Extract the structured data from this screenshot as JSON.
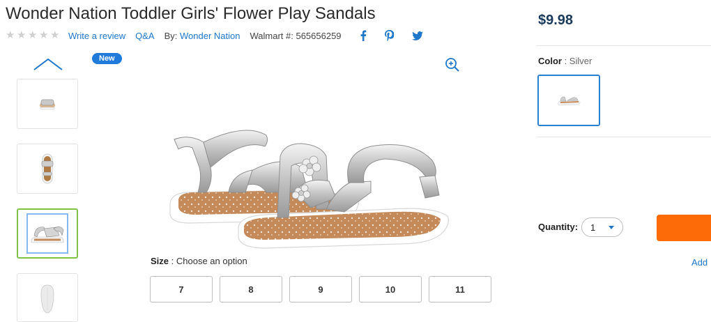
{
  "product": {
    "title": "Wonder Nation Toddler Girls' Flower Play Sandals",
    "rating_stars": 5,
    "write_review": "Write a review",
    "qa": "Q&A",
    "by_label": "By:",
    "brand": "Wonder Nation",
    "walmart_label": "Walmart #: 565656259"
  },
  "social": {
    "icons": [
      "facebook-icon",
      "pinterest-icon",
      "twitter-icon"
    ],
    "color": "#1f77c9"
  },
  "gallery": {
    "badge": "New",
    "selected_thumb_index": 2
  },
  "size": {
    "label": "Size",
    "separator": " : ",
    "prompt": "Choose an option",
    "options": [
      "7",
      "8",
      "9",
      "10",
      "11"
    ]
  },
  "price": "$9.98",
  "color": {
    "label": "Color",
    "separator": " : ",
    "value": "Silver"
  },
  "quantity": {
    "label": "Quantity:",
    "value": "1"
  },
  "actions": {
    "add_link": "Add"
  },
  "colors": {
    "accent": "#1f77c9",
    "cart": "#fd6b08",
    "badge": "#1f7ad9",
    "price": "#1a3a5c"
  }
}
